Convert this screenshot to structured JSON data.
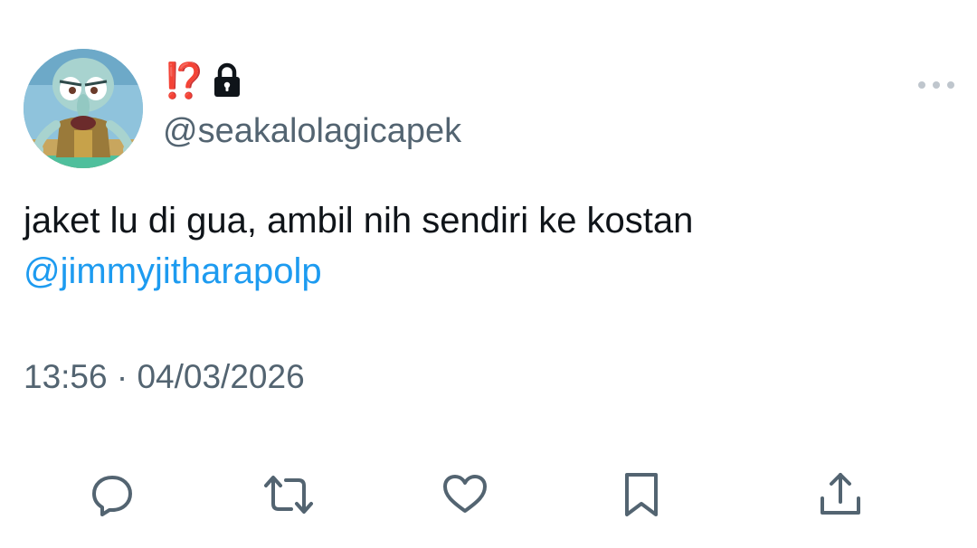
{
  "tweet": {
    "author": {
      "display_name": "⁉️",
      "protected_icon": "lock-icon",
      "handle": "@seakalolagicapek",
      "avatar": "squidward-avatar"
    },
    "text_line_1": "jaket lu di gua, ambil nih sendiri ke kostan",
    "mention": "@jimmyjitharapolp",
    "timestamp": "13:56 · 04/03/2026",
    "more_icon": "more-horizontal-icon",
    "actions": [
      {
        "icon": "reply-icon"
      },
      {
        "icon": "retweet-icon"
      },
      {
        "icon": "like-icon"
      },
      {
        "icon": "bookmark-icon"
      },
      {
        "icon": "share-icon"
      }
    ]
  },
  "colors": {
    "text": "#0f1419",
    "secondary": "#536471",
    "link": "#1d9bf0",
    "emoji_red": "#e0282e"
  }
}
